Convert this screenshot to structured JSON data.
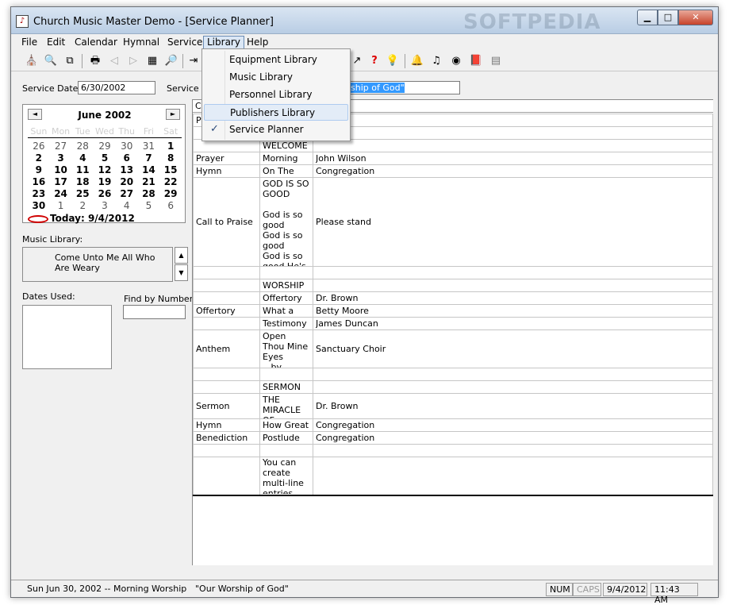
{
  "window": {
    "title": "Church Music Master Demo - [Service Planner]",
    "watermark": "SOFTPEDIA",
    "caption_buttons": {
      "minimize": "▁",
      "maximize": "□",
      "close": "✕"
    }
  },
  "menu": [
    "File",
    "Edit",
    "Calendar",
    "Hymnal",
    "Service",
    "Library",
    "Help"
  ],
  "library_menu": {
    "items": [
      "Equipment Library",
      "Music Library",
      "Personnel Library",
      "Publishers Library",
      "Service Planner"
    ],
    "checked": "Service Planner",
    "hovered": "Publishers Library",
    "check_mark": "✓"
  },
  "toolbar": {
    "icons": [
      "bible-icon",
      "search-book-icon",
      "copy-icon",
      "print-icon",
      "page-back-icon",
      "page-forward-icon",
      "calendar-icon",
      "find-icon",
      "arrow-in-icon",
      "chart-icon",
      "help-icon",
      "lightbulb-icon",
      "bell-icon",
      "music-note-icon",
      "cd-icon",
      "book-icon",
      "calculator-icon"
    ],
    "glyphs": [
      "⛪",
      "🔍",
      "⧉",
      "🖶",
      "◁",
      "▷",
      "▦",
      "🔎",
      "⇥",
      "↗",
      "?",
      "💡",
      "🔔",
      "♫",
      "◉",
      "📕",
      "▤"
    ]
  },
  "service": {
    "date_label": "Service Date:",
    "date_value": "6/30/2002",
    "type_label": "Service T",
    "title_value": "ship of God\""
  },
  "calendar": {
    "month": "June 2002",
    "prev": "◄",
    "next": "►",
    "dow": [
      "Sun",
      "Mon",
      "Tue",
      "Wed",
      "Thu",
      "Fri",
      "Sat"
    ],
    "weeks": [
      [
        "26",
        "27",
        "28",
        "29",
        "30",
        "31",
        "1"
      ],
      [
        "2",
        "3",
        "4",
        "5",
        "6",
        "7",
        "8"
      ],
      [
        "9",
        "10",
        "11",
        "12",
        "13",
        "14",
        "15"
      ],
      [
        "16",
        "17",
        "18",
        "19",
        "20",
        "21",
        "22"
      ],
      [
        "23",
        "24",
        "25",
        "26",
        "27",
        "28",
        "29"
      ],
      [
        "30",
        "1",
        "2",
        "3",
        "4",
        "5",
        "6"
      ]
    ],
    "today_text": "Today: 9/4/2012"
  },
  "music_library": {
    "label": "Music Library:",
    "value": "Come Unto Me All Who Are Weary",
    "up": "▲",
    "down": "▼"
  },
  "dates_used": {
    "label": "Dates Used:"
  },
  "find_by_number": {
    "label": "Find by Number:",
    "value": ""
  },
  "grid": {
    "header_fragment": "Co",
    "rows": [
      [
        "Pr",
        "",
        "th"
      ],
      [
        "",
        "",
        ""
      ],
      [
        "",
        "WELCOME",
        ""
      ],
      [
        "Prayer",
        "Morning",
        "John Wilson"
      ],
      [
        "Hymn",
        "On The",
        "Congregation"
      ],
      [
        "Call to Praise",
        "GOD IS SO GOOD\n\nGod is so good\nGod is so good\nGod is so good He's",
        "Please stand"
      ],
      [
        "",
        "",
        ""
      ],
      [
        "",
        "WORSHIP",
        ""
      ],
      [
        "",
        "Offertory",
        "Dr. Brown"
      ],
      [
        "Offertory",
        "What a",
        "Betty Moore"
      ],
      [
        "",
        "Testimony",
        "James Duncan"
      ],
      [
        "Anthem",
        "Open Thou Mine Eyes\n   by\nMichael Cox",
        "Sanctuary Choir"
      ],
      [
        "",
        "",
        ""
      ],
      [
        "",
        "SERMON",
        ""
      ],
      [
        "Sermon",
        "THE MIRACLE OF",
        "Dr. Brown"
      ],
      [
        "Hymn",
        "How Great",
        "Congregation"
      ],
      [
        "Benediction",
        "Postlude",
        "Congregation"
      ],
      [
        "",
        "",
        ""
      ],
      [
        "",
        "You can create multi-line entries",
        ""
      ]
    ]
  },
  "status": {
    "left": "Sun Jun 30, 2002  --  Morning Worship",
    "service": "\"Our Worship of God\"",
    "num": "NUM",
    "caps": "CAPS",
    "date": "9/4/2012",
    "time": "11:43 AM"
  }
}
